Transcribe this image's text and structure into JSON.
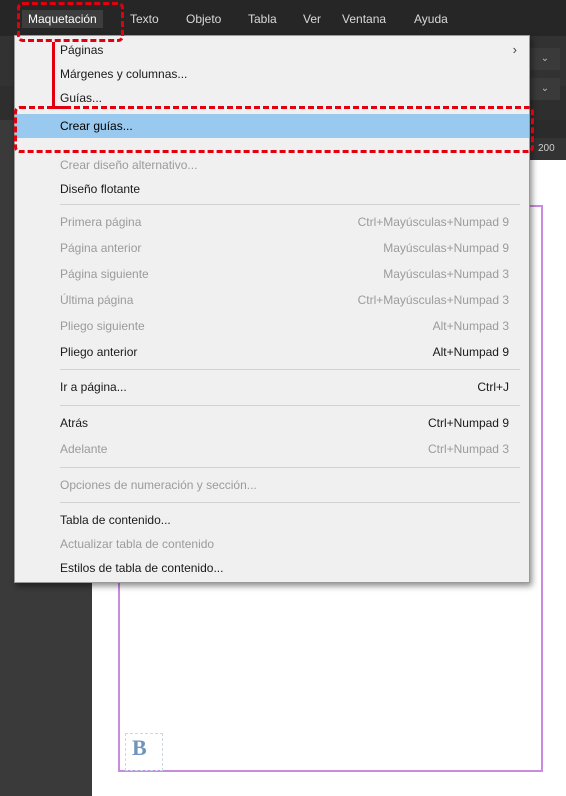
{
  "menubar": {
    "items": [
      {
        "label": "Maquetación",
        "active": true
      },
      {
        "label": "Texto"
      },
      {
        "label": "Objeto"
      },
      {
        "label": "Tabla"
      },
      {
        "label": "Ver"
      },
      {
        "label": "Ventana"
      },
      {
        "label": "Ayuda"
      }
    ]
  },
  "ruler": {
    "number": "200"
  },
  "canvas": {
    "frame_letter": "B"
  },
  "menu": {
    "items": [
      {
        "label": "Páginas",
        "submenu": true
      },
      {
        "label": "Márgenes y columnas..."
      },
      {
        "label": "Guías..."
      },
      {
        "label": "Crear guías...",
        "highlighted": true
      },
      {
        "label": "Crear diseño alternativo...",
        "disabled": true
      },
      {
        "label": "Diseño flotante"
      },
      {
        "label": "Primera página",
        "shortcut": "Ctrl+Mayúsculas+Numpad 9",
        "disabled": true
      },
      {
        "label": "Página anterior",
        "shortcut": "Mayúsculas+Numpad 9",
        "disabled": true
      },
      {
        "label": "Página siguiente",
        "shortcut": "Mayúsculas+Numpad 3",
        "disabled": true
      },
      {
        "label": "Última página",
        "shortcut": "Ctrl+Mayúsculas+Numpad 3",
        "disabled": true
      },
      {
        "label": "Pliego siguiente",
        "shortcut": "Alt+Numpad 3",
        "disabled": true
      },
      {
        "label": "Pliego anterior",
        "shortcut": "Alt+Numpad 9"
      },
      {
        "label": "Ir a página...",
        "shortcut": "Ctrl+J"
      },
      {
        "label": "Atrás",
        "shortcut": "Ctrl+Numpad 9"
      },
      {
        "label": "Adelante",
        "shortcut": "Ctrl+Numpad 3",
        "disabled": true
      },
      {
        "label": "Opciones de numeración y sección...",
        "disabled": true
      },
      {
        "label": "Tabla de contenido..."
      },
      {
        "label": "Actualizar tabla de contenido",
        "disabled": true
      },
      {
        "label": "Estilos de tabla de contenido..."
      }
    ]
  },
  "colors": {
    "menu_bg": "#f0f0f0",
    "highlight": "#99c9ef",
    "annotation": "#e2000f",
    "page_border": "#c98be0"
  }
}
